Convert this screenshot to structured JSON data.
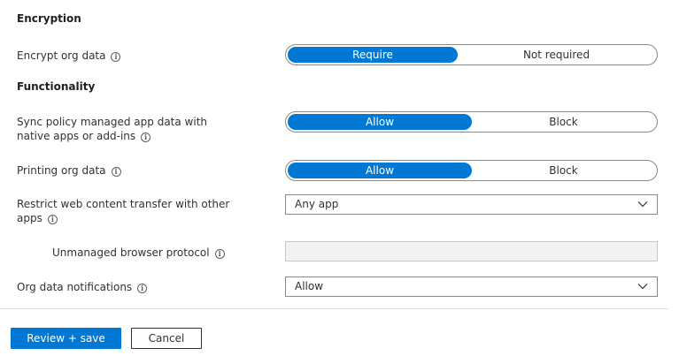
{
  "encryption": {
    "heading": "Encryption",
    "encrypt_org_data": {
      "label": "Encrypt org data",
      "options": [
        "Require",
        "Not required"
      ],
      "selected": "Require"
    }
  },
  "functionality": {
    "heading": "Functionality",
    "sync_policy": {
      "label_line1": "Sync policy managed app data with",
      "label_line2": "native apps or add-ins",
      "options": [
        "Allow",
        "Block"
      ],
      "selected": "Allow"
    },
    "printing": {
      "label": "Printing org data",
      "options": [
        "Allow",
        "Block"
      ],
      "selected": "Allow"
    },
    "restrict_web": {
      "label_line1": "Restrict web content transfer with other",
      "label_line2": "apps",
      "value": "Any app"
    },
    "unmanaged_browser": {
      "label": "Unmanaged browser protocol",
      "value": ""
    },
    "org_notifications": {
      "label": "Org data notifications",
      "value": "Allow"
    }
  },
  "footer": {
    "review_save": "Review + save",
    "cancel": "Cancel"
  },
  "icons": {
    "info": "i",
    "chevron": "chevron-down-icon"
  },
  "colors": {
    "accent": "#0078d4",
    "border": "#8a8886",
    "disabled_bg": "#f3f2f1",
    "text": "#323130"
  }
}
